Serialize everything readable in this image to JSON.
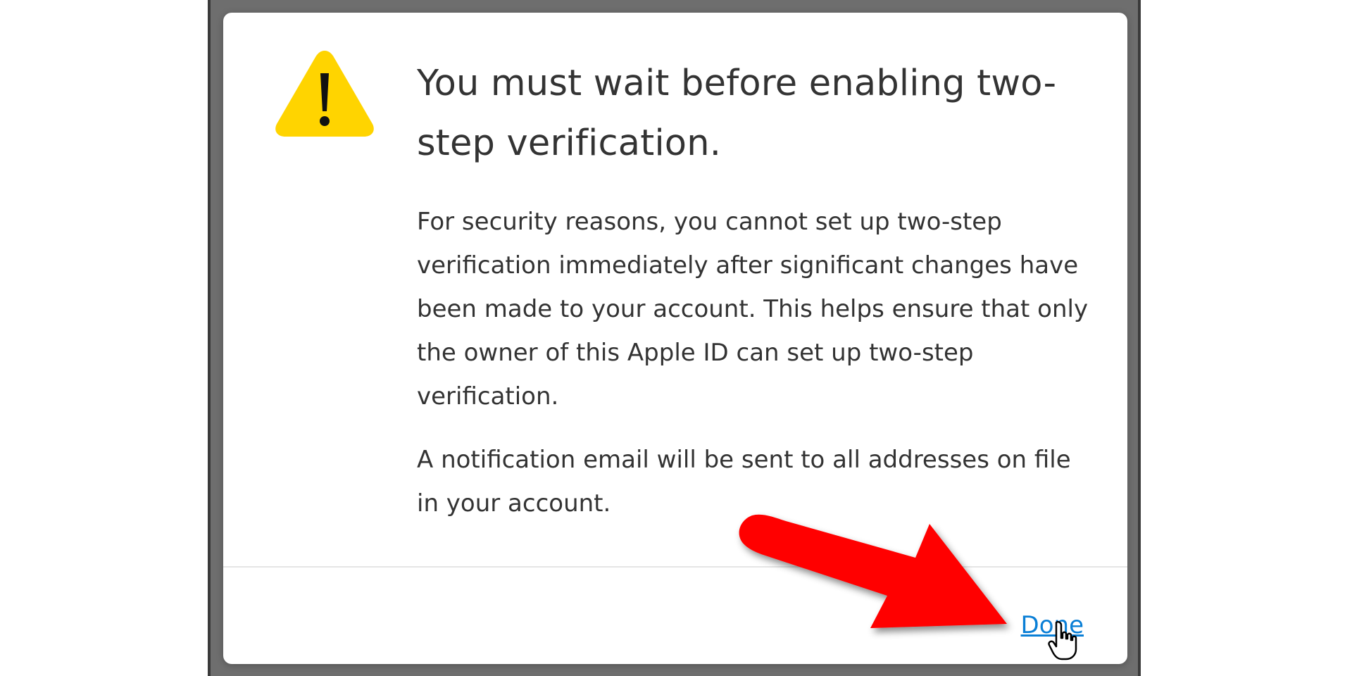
{
  "dialog": {
    "title": "You must wait before enabling two-step verification.",
    "paragraphs": [
      "For security reasons, you cannot set up two-step verification immediately after significant changes have been made to your account. This helps ensure that only the owner of this Apple ID can set up two-step verification.",
      "A notification email will be sent to all addresses on file in your account."
    ],
    "done_label": "Done",
    "icon": "warning-icon"
  },
  "annotation": {
    "arrow_color": "#ff0000",
    "cursor": "hand-pointer-icon"
  },
  "colors": {
    "link": "#0a7fd6",
    "warning": "#ffd400",
    "backdrop": "#6e6e6e"
  }
}
